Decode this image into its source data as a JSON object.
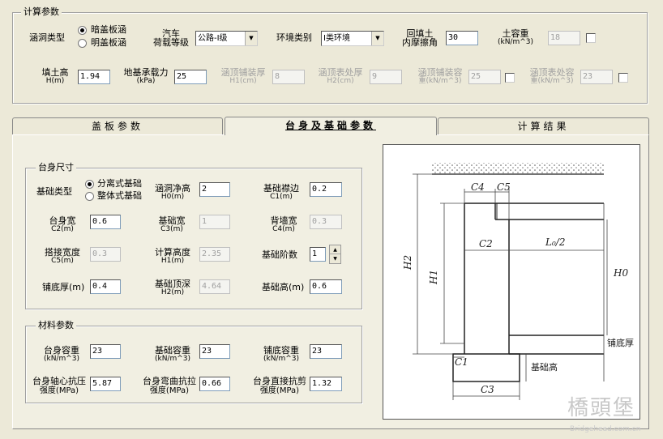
{
  "calc_params": {
    "title": "计算参数",
    "culvert_type": {
      "label": "涵洞类型",
      "options": [
        "暗盖板涵",
        "明盖板涵"
      ],
      "selected": 0
    },
    "vehicle_load": {
      "label_line1": "汽车",
      "label_line2": "荷载等级",
      "value": "公路-I级"
    },
    "environment": {
      "label": "环境类别",
      "value": "I类环境"
    },
    "backfill_angle": {
      "label_line1": "回填土",
      "label_line2": "内摩擦角",
      "value": "30"
    },
    "soil_weight": {
      "label_line1": "土容重",
      "label_line2": "(kN/m^3)",
      "value": "18"
    },
    "fill_height": {
      "label_line1": "填土高",
      "label_line2": "H(m)",
      "value": "1.94"
    },
    "bearing": {
      "label_line1": "地基承载力",
      "label_line2": "(kPa)",
      "value": "25"
    },
    "pave_thick": {
      "label_line1": "涵顶铺装厚",
      "label_line2": "H1(cm)",
      "value": "8"
    },
    "surface_thick": {
      "label_line1": "涵顶表处厚",
      "label_line2": "H2(cm)",
      "value": "9"
    },
    "pave_weight": {
      "label_line1": "涵顶铺装容",
      "label_line2": "重(kN/m^3)",
      "value": "25"
    },
    "surface_weight": {
      "label_line1": "涵顶表处容",
      "label_line2": "重(kN/m^3)",
      "value": "23"
    }
  },
  "tabs": [
    "盖板参数",
    "台身及基础参数",
    "计算结果"
  ],
  "abutment": {
    "title": "台身尺寸",
    "foundation_type": {
      "label": "基础类型",
      "options": [
        "分离式基础",
        "整体式基础"
      ],
      "selected": 0
    },
    "clear_height": {
      "label_line1": "涵洞净高",
      "label_line2": "H0(m)",
      "value": "2"
    },
    "found_offset": {
      "label_line1": "基础襟边",
      "label_line2": "C1(m)",
      "value": "0.2"
    },
    "body_width": {
      "label_line1": "台身宽",
      "label_line2": "C2(m)",
      "value": "0.6"
    },
    "found_width": {
      "label_line1": "基础宽",
      "label_line2": "C3(m)",
      "value": "1"
    },
    "back_width": {
      "label_line1": "背墙宽",
      "label_line2": "C4(m)",
      "value": "0.3"
    },
    "lap_width": {
      "label_line1": "搭接宽度",
      "label_line2": "C5(m)",
      "value": "0.3"
    },
    "calc_height": {
      "label_line1": "计算高度",
      "label_line2": "H1(m)",
      "value": "2.35"
    },
    "found_steps": {
      "label": "基础阶数",
      "value": "1"
    },
    "bed_thick": {
      "label": "铺底厚(m)",
      "value": "0.4"
    },
    "found_depth": {
      "label_line1": "基础顶深",
      "label_line2": "H2(m)",
      "value": "4.64"
    },
    "found_height": {
      "label": "基础高(m)",
      "value": "0.6"
    }
  },
  "material": {
    "title": "材料参数",
    "body_weight": {
      "label_line1": "台身容重",
      "label_line2": "(kN/m^3)",
      "value": "23"
    },
    "found_weight": {
      "label_line1": "基础容重",
      "label_line2": "(kN/m^3)",
      "value": "23"
    },
    "bed_weight": {
      "label_line1": "铺底容重",
      "label_line2": "(kN/m^3)",
      "value": "23"
    },
    "axial_strength": {
      "label_line1": "台身轴心抗压",
      "label_line2": "强度(MPa)",
      "value": "5.87"
    },
    "bend_strength": {
      "label_line1": "台身弯曲抗拉",
      "label_line2": "强度(MPa)",
      "value": "0.66"
    },
    "shear_strength": {
      "label_line1": "台身直接抗剪",
      "label_line2": "强度(MPa)",
      "value": "1.32"
    }
  },
  "diagram": {
    "c4": "C4",
    "c5": "C5",
    "c2": "C2",
    "l0": "L₀/2",
    "h2": "H2",
    "h1": "H1",
    "h0": "H0",
    "c1": "C1",
    "c3": "C3",
    "bed": "铺底厚",
    "found_h": "基础高"
  },
  "watermark": {
    "main": "橋頭堡",
    "url": "Bridgehead.com.cn"
  }
}
